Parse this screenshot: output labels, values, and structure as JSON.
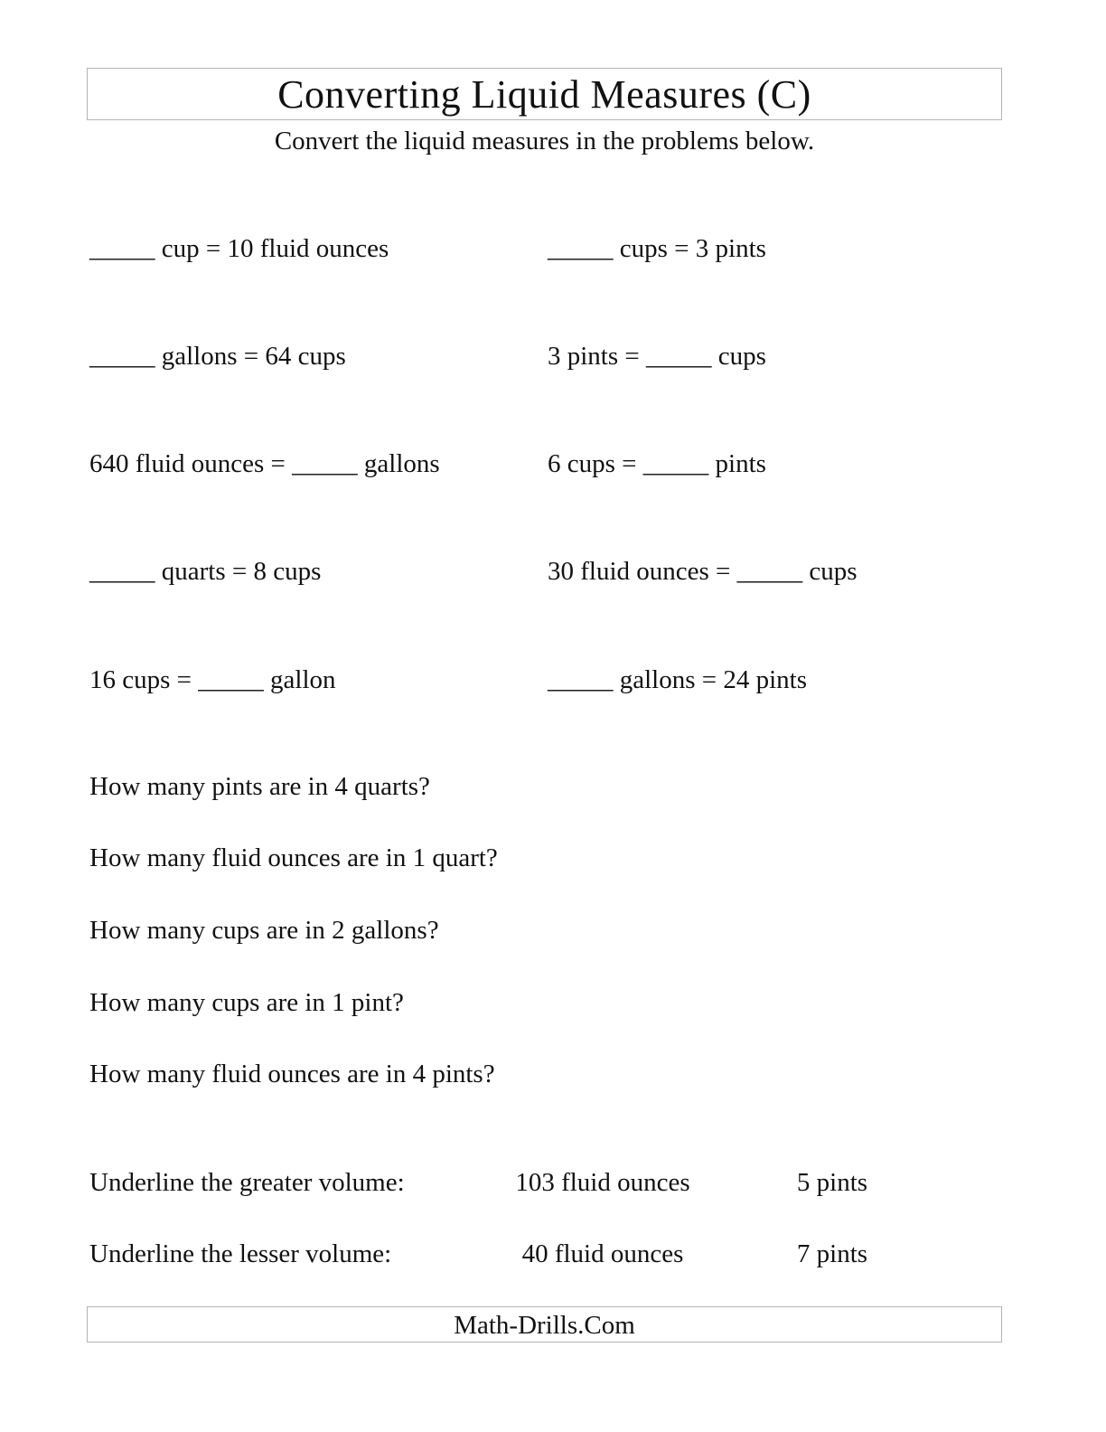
{
  "header": {
    "title": "Converting Liquid Measures (C)",
    "instructions": "Convert the liquid measures in the problems below."
  },
  "conversions": {
    "left": [
      "_____ cup = 10 fluid ounces",
      "_____ gallons = 64 cups",
      "640 fluid ounces = _____ gallons",
      "_____ quarts = 8 cups",
      "16 cups = _____ gallon"
    ],
    "right": [
      "_____ cups = 3 pints",
      "3 pints = _____ cups",
      "6 cups = _____ pints",
      "30 fluid ounces = _____ cups",
      "_____ gallons = 24 pints"
    ]
  },
  "questions": [
    "How many pints are in 4 quarts?",
    "How many fluid ounces are in 1 quart?",
    "How many cups are in 2 gallons?",
    "How many cups are in 1 pint?",
    "How many fluid ounces are in 4 pints?"
  ],
  "comparisons": [
    {
      "label": "Underline the greater volume:",
      "option_a": "103 fluid ounces",
      "option_b": "5 pints"
    },
    {
      "label": "Underline the lesser volume:",
      "option_a": "40 fluid ounces",
      "option_b": "7 pints"
    }
  ],
  "footer": {
    "text": "Math-Drills.Com"
  }
}
